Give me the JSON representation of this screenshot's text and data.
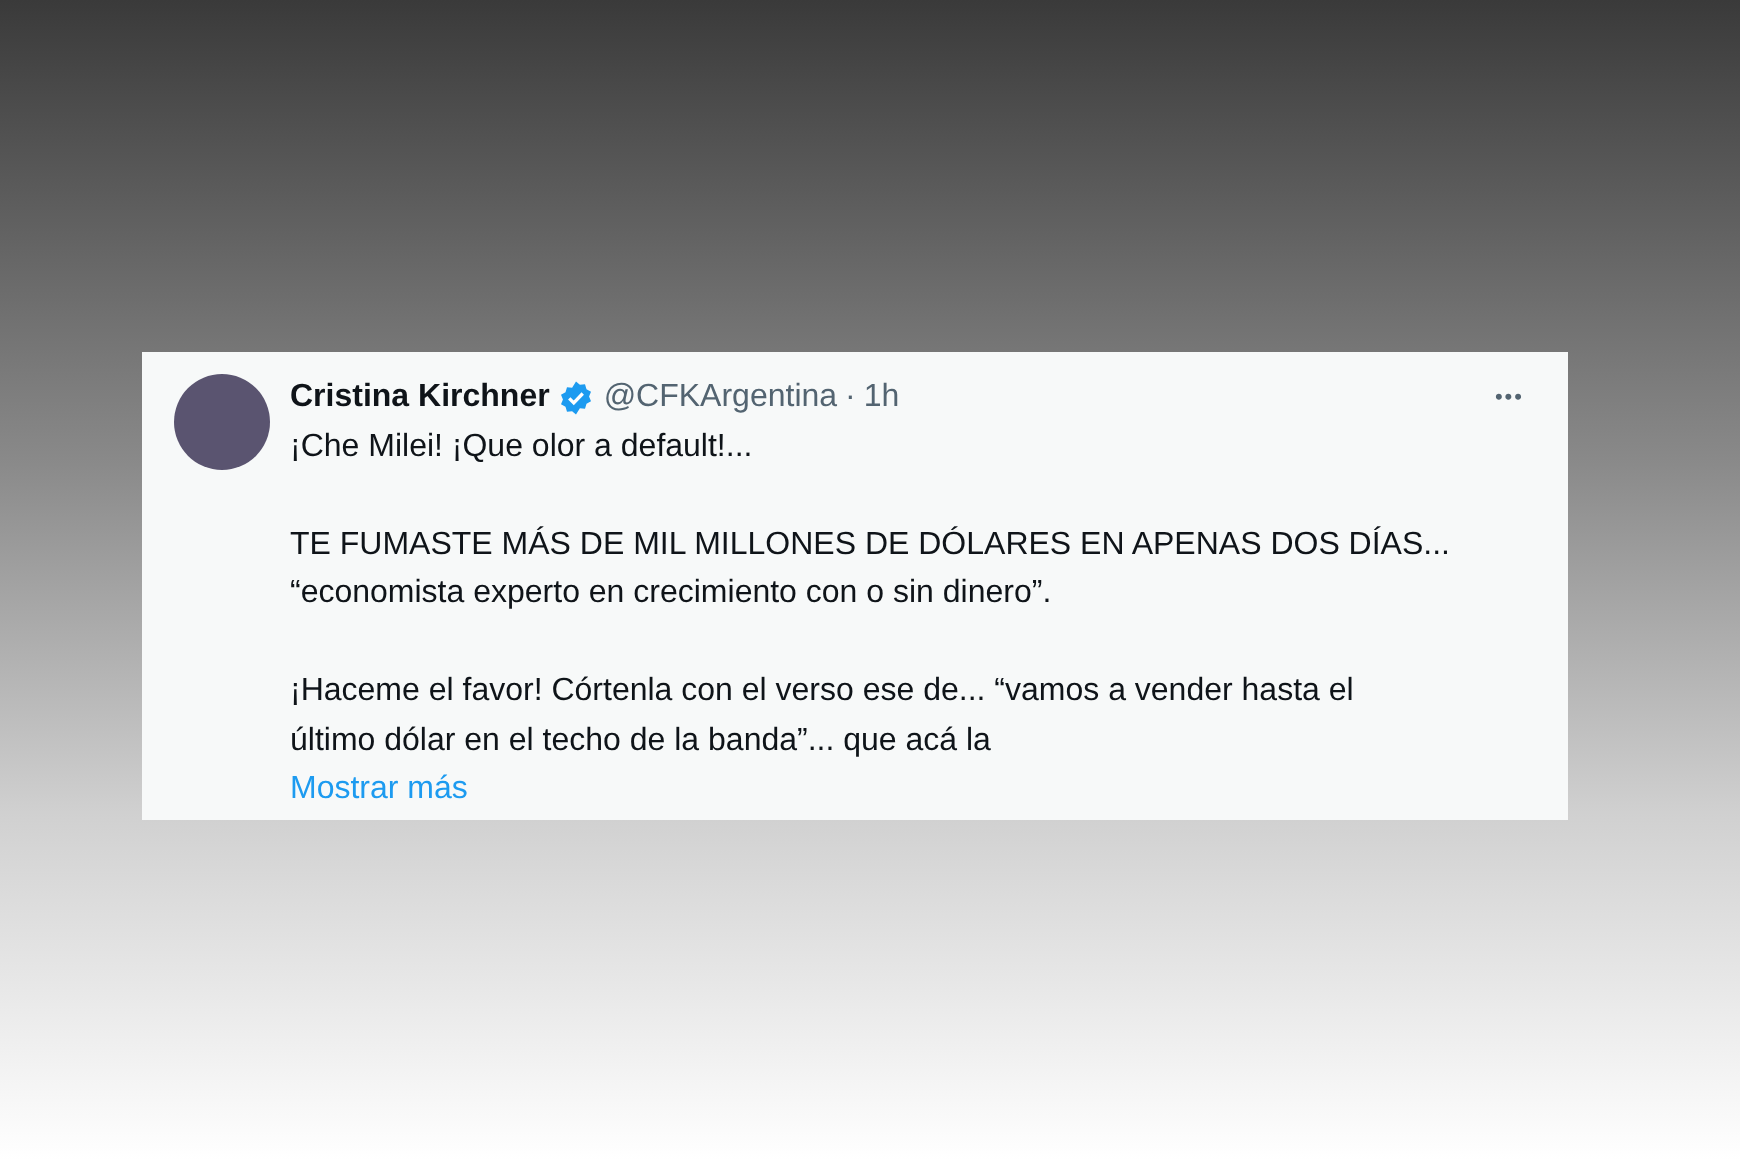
{
  "post": {
    "author": "Cristina Kirchner",
    "verified": true,
    "handle": "@CFKArgentina",
    "separator": "·",
    "time": "1h",
    "more_menu": "•••",
    "paragraphs": [
      [
        "¡Che Milei! ¡Que olor a default!..."
      ],
      [
        "TE FUMASTE MÁS DE MIL MILLONES DE DÓLARES EN APENAS DOS DÍAS...",
        "“economista experto en crecimiento con o sin dinero”."
      ],
      [
        "¡Haceme el favor! Córtenla con el verso ese de... “vamos a vender hasta el",
        "último dólar en el techo de la banda”... que acá la"
      ]
    ],
    "show_more": "Mostrar más"
  }
}
